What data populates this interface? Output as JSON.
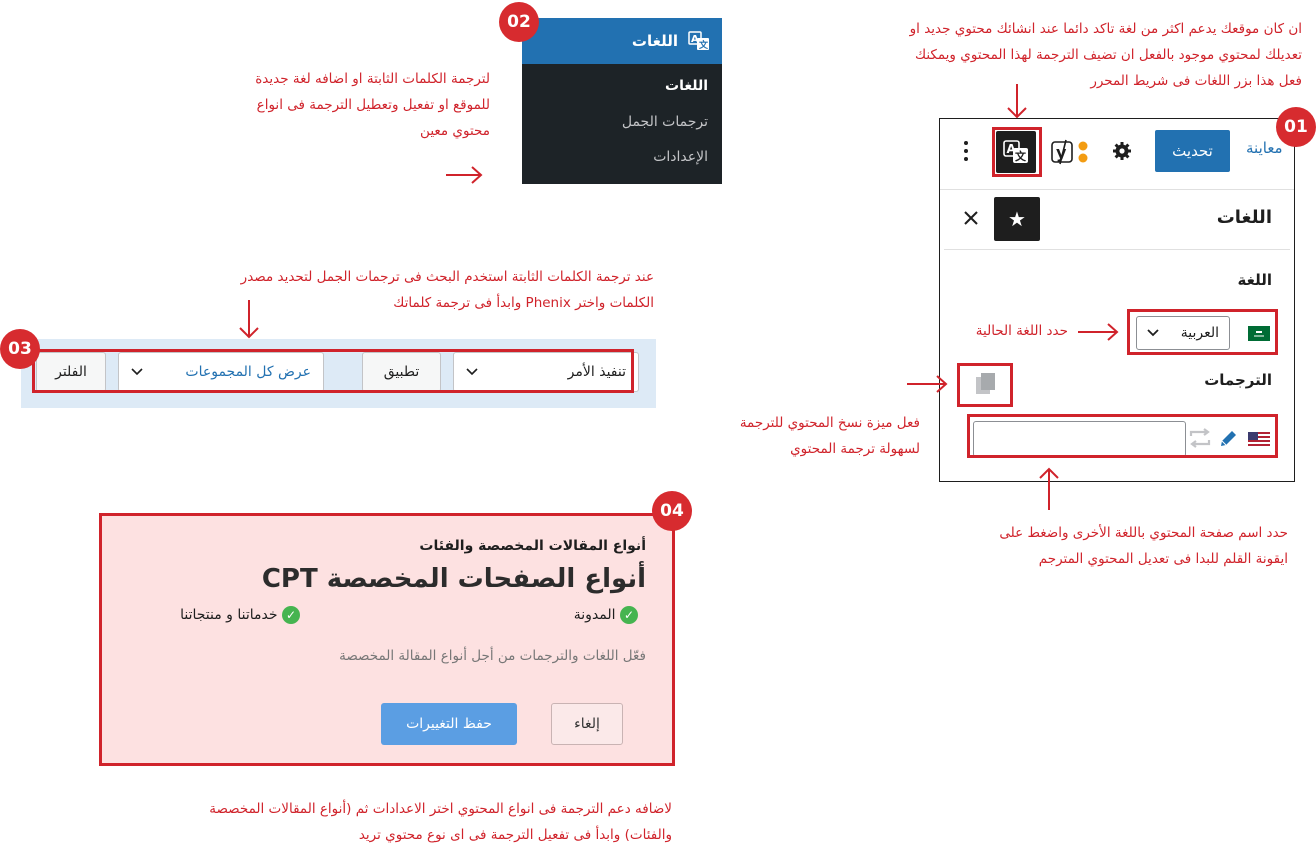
{
  "annotations": {
    "top_right": [
      "ان كان موقعك يدعم اكثر من لغة تاكد دائما عند انشائك محتوي جديد او",
      "تعديلك لمحتوي موجود بالفعل ان تضيف الترجمة لهذا المحتوي ويمكنك",
      "فعل هذا بزر اللغات فى شريط المحرر"
    ],
    "menu_note": [
      "لترجمة الكلمات الثابتة او اضافه لغة جديدة",
      "للموقع او تفعيل وتعطيل الترجمة فى انواع",
      "محتوي معين"
    ],
    "language_note": "حدد اللغة الحالية",
    "copy_note": [
      "فعل ميزة نسخ المحتوي للترجمة",
      "لسهولة ترجمة المحتوي"
    ],
    "translation_note": [
      "حدد اسم صفحة المحتوي باللغة الأخرى واضغط على",
      "ايقونة القلم للبدا فى تعديل المحتوي المترجم"
    ],
    "filter_note": [
      "عند ترجمة الكلمات الثابتة استخدم البحث فى ترجمات الجمل لتحديد مصدر",
      "الكلمات واختر Phenix وابدأ فى ترجمة كلماتك"
    ],
    "cpt_note": [
      "لاضافه دعم الترجمة فى انواع المحتوي اختر الاعدادات ثم (أنواع المقالات المخصصة",
      "والفئات) وابدأ فى تفعيل الترجمة فى اى نوع محتوي تريد"
    ]
  },
  "badges": [
    "01",
    "02",
    "03",
    "04"
  ],
  "admin_menu": {
    "title": "اللغات",
    "icon": "translate-icon",
    "items": [
      "اللغات",
      "ترجمات الجمل",
      "الإعدادات"
    ]
  },
  "editor": {
    "preview": "معاينة",
    "update": "تحديث",
    "icons": [
      "settings-gear-icon",
      "yoast-icon",
      "translate-icon",
      "more-options-icon"
    ],
    "sidebar_title": "اللغات",
    "language_label": "اللغة",
    "current_language": "العربية",
    "translations_label": "الترجمات",
    "translation_input_value": ""
  },
  "filter_bar": {
    "bulk_action": "تنفيذ الأمر",
    "apply": "تطبيق",
    "groups": "عرض كل المجموعات",
    "filter": "الفلتر"
  },
  "cpt": {
    "section_label": "أنواع المقالات المخصصة والفئات",
    "heading": "أنواع الصفحات المخصصة CPT",
    "options": [
      "المدونة",
      "خدماتنا و منتجاتنا"
    ],
    "description": "فعّل اللغات والترجمات من أجل أنواع المقالة المخصصة",
    "save": "حفظ التغييرات",
    "cancel": "إلغاء"
  },
  "colors": {
    "accent_red": "#d0232b",
    "wp_blue": "#2271b1",
    "admin_dark": "#1d2327",
    "check_green": "#46b450"
  }
}
